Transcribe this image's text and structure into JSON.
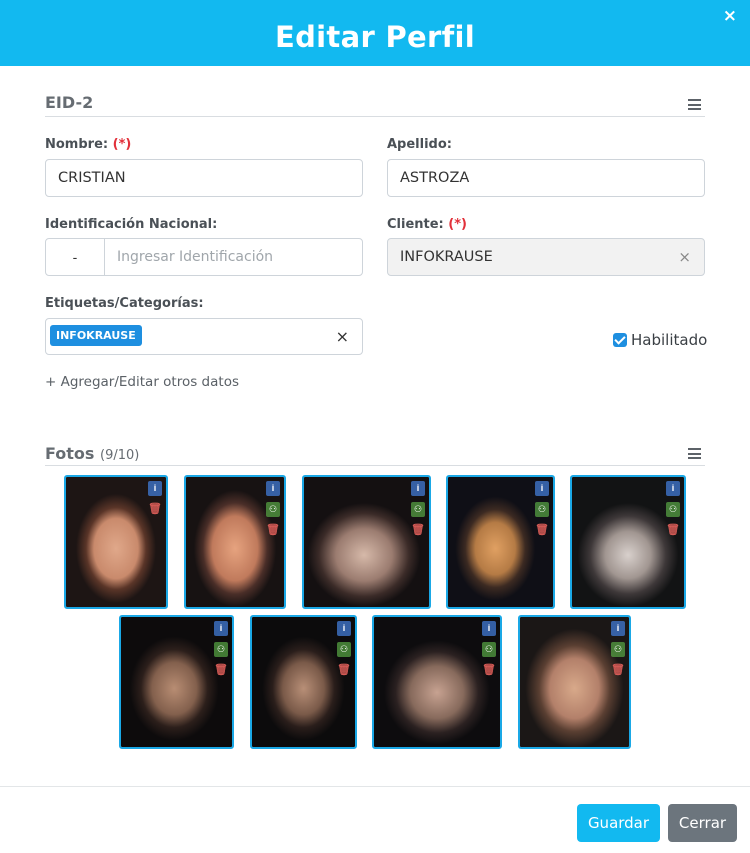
{
  "header": {
    "title": "Editar Perfil",
    "close_label": "×"
  },
  "profile_section": {
    "title": "EID-2",
    "menu_icon": "hamburger-icon"
  },
  "fields": {
    "nombre": {
      "label": "Nombre:",
      "required": "(*)",
      "value": "CRISTIAN"
    },
    "apellido": {
      "label": "Apellido:",
      "value": "ASTROZA"
    },
    "identificacion": {
      "label": "Identificación Nacional:",
      "prefix": "-",
      "placeholder": "Ingresar Identificación",
      "value": ""
    },
    "cliente": {
      "label": "Cliente:",
      "required": "(*)",
      "value": "INFOKRAUSE",
      "clear": "×"
    },
    "etiquetas": {
      "label": "Etiquetas/Categorías:",
      "tags": [
        "INFOKRAUSE"
      ],
      "clear": "×"
    }
  },
  "habilitado": {
    "label": "Habilitado",
    "checked": true
  },
  "add_link": "+ Agregar/Editar otros datos",
  "photos_section": {
    "title": "Fotos",
    "count": "(9/10)",
    "menu_icon": "hamburger-icon"
  },
  "photo_actions": {
    "info": "i",
    "user": "⚇",
    "delete": "🗑"
  },
  "photos": [
    {
      "name": "photo-1"
    },
    {
      "name": "photo-2"
    },
    {
      "name": "photo-3"
    },
    {
      "name": "photo-4"
    },
    {
      "name": "photo-5"
    },
    {
      "name": "photo-6"
    },
    {
      "name": "photo-7"
    },
    {
      "name": "photo-8"
    },
    {
      "name": "photo-9"
    }
  ],
  "footer": {
    "save_label": "Guardar",
    "close_label": "Cerrar"
  },
  "colors": {
    "accent": "#12b9f0",
    "tag": "#1e8fe0",
    "required": "#e2303a",
    "secondary_button": "#6c757d"
  }
}
